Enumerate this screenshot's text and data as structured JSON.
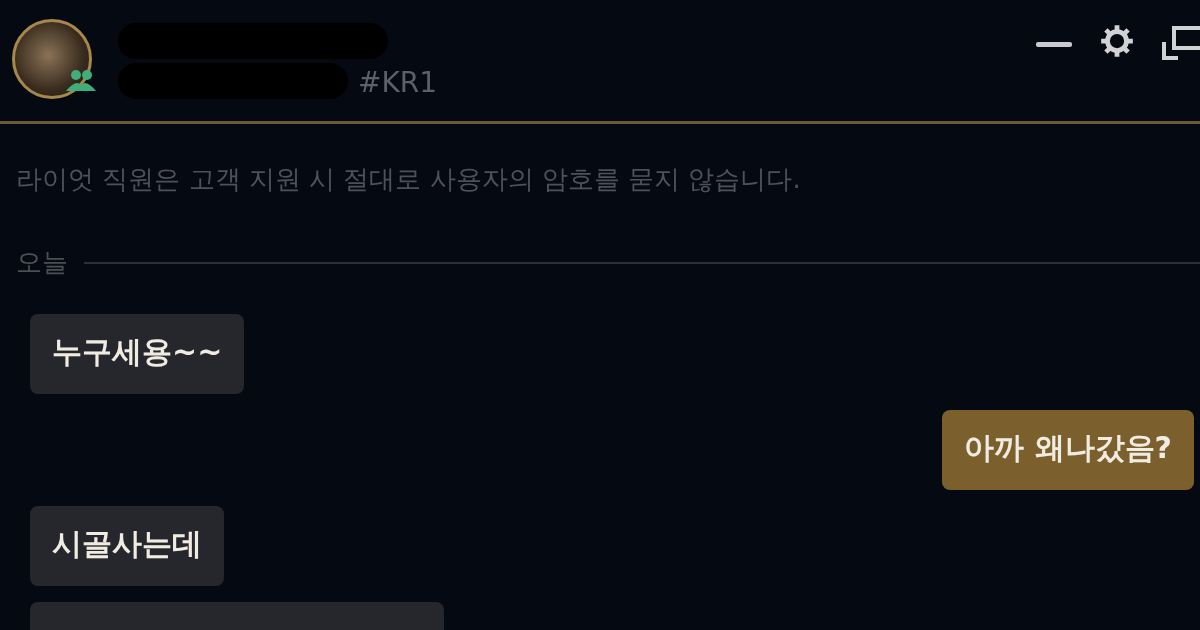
{
  "header": {
    "tag": "#KR1"
  },
  "notice": "라이엇 직원은 고객 지원 시 절대로 사용자의 암호를 묻지 않습니다.",
  "divider_label": "오늘",
  "messages": [
    {
      "text": "누구세용~~",
      "kind": "incoming",
      "cut": false
    },
    {
      "text": "아까 왜나갔음?",
      "kind": "outgoing",
      "cut": false
    },
    {
      "text": "시골사는데",
      "kind": "incoming",
      "cut": false
    },
    {
      "kind": "incoming",
      "cut": true
    }
  ]
}
